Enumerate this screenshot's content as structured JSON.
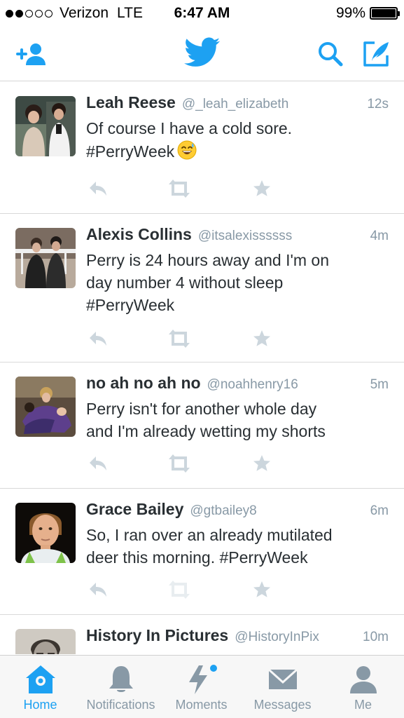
{
  "status_bar": {
    "carrier": "Verizon",
    "network": "LTE",
    "time": "6:47 AM",
    "battery_text": "99%",
    "battery_level": 0.99,
    "signal_bars": 2,
    "signal_total": 5
  },
  "nav": {
    "icons": [
      "add-user-icon",
      "twitter-bird-icon",
      "search-icon",
      "compose-icon"
    ],
    "accent": "#1da1f2"
  },
  "tweets": [
    {
      "name": "Leah Reese",
      "handle": "@_leah_elizabeth",
      "time": "12s",
      "lines": [
        "Of course I have a cold sore.",
        "#PerryWeek"
      ],
      "emoji": "sweat-smile-emoji"
    },
    {
      "name": "Alexis Collins",
      "handle": "@itsalexissssss",
      "time": "4m",
      "lines": [
        "Perry is 24 hours away and I'm on",
        "day number 4 without sleep",
        "#PerryWeek"
      ]
    },
    {
      "name": "no ah no ah no",
      "handle": "@noahhenry16",
      "time": "5m",
      "lines": [
        "Perry isn't for another whole day",
        "and I'm already wetting my shorts"
      ]
    },
    {
      "name": "Grace Bailey",
      "handle": "@gtbailey8",
      "time": "6m",
      "lines": [
        "So, I ran over an already mutilated",
        "deer this morning. #PerryWeek"
      ]
    },
    {
      "name": "History In Pictures",
      "handle": "@HistoryInPix",
      "time": "10m",
      "lines": []
    }
  ],
  "tabs": [
    {
      "label": "Home",
      "icon": "home-icon",
      "active": true
    },
    {
      "label": "Notifications",
      "icon": "bell-icon",
      "active": false
    },
    {
      "label": "Moments",
      "icon": "lightning-icon",
      "active": false,
      "has_dot": true
    },
    {
      "label": "Messages",
      "icon": "envelope-icon",
      "active": false
    },
    {
      "label": "Me",
      "icon": "person-icon",
      "active": false
    }
  ],
  "colors": {
    "accent": "#1da1f2",
    "muted": "#8899a6",
    "text": "#292f33",
    "action_icon": "#ccd6dd"
  }
}
